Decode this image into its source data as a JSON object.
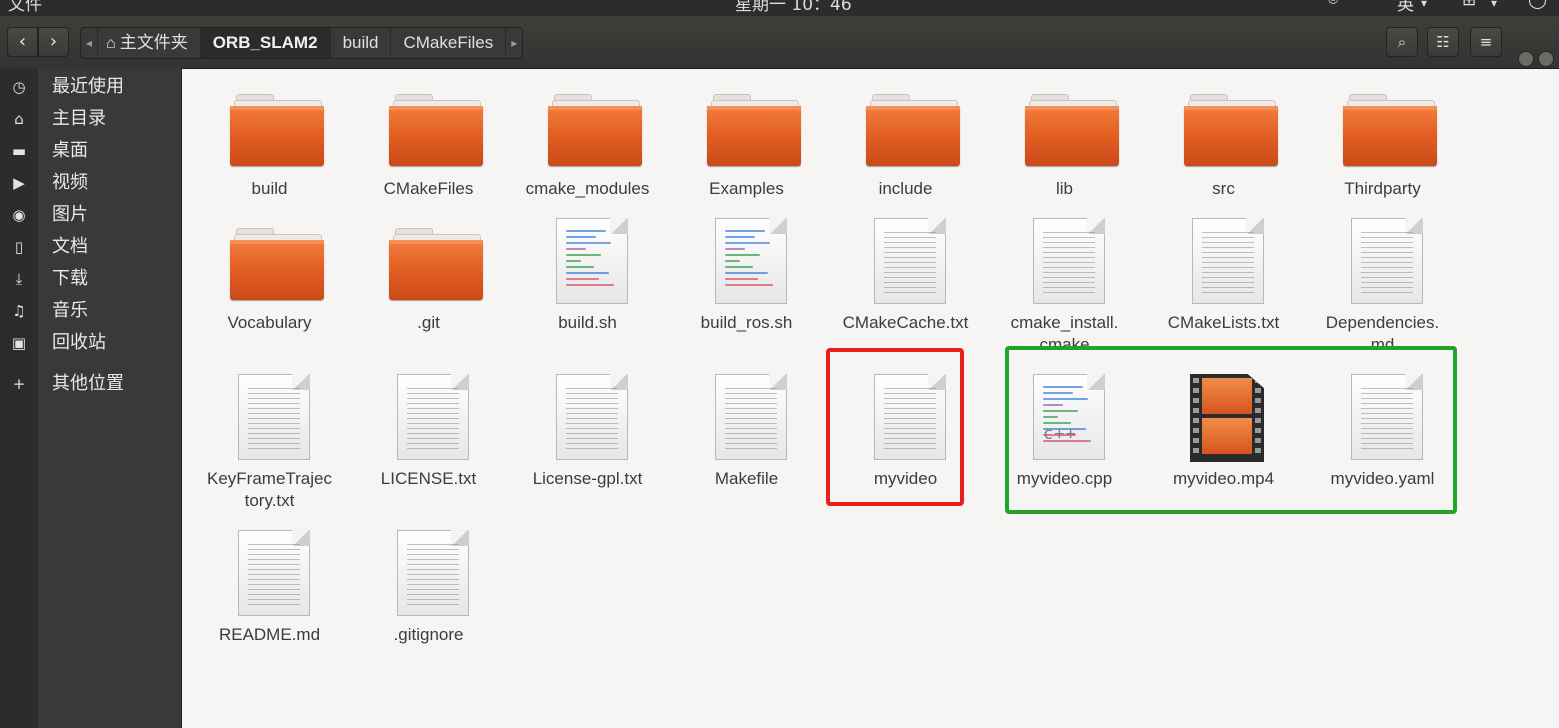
{
  "topbar": {
    "app_menu": "文件",
    "clock": "星期一 10：46",
    "input_method": "英"
  },
  "headerbar": {
    "back": "‹",
    "forward": "›",
    "path": [
      {
        "label": "主文件夹",
        "icon": "home-icon"
      },
      {
        "label": "ORB_SLAM2",
        "current": true
      },
      {
        "label": "build"
      },
      {
        "label": "CMakeFiles"
      }
    ],
    "search_icon": "search-icon",
    "view_icon": "view-options-icon",
    "menu_icon": "hamburger-menu-icon"
  },
  "sidebar": {
    "items": [
      {
        "label": "最近使用",
        "icon": "clock-icon"
      },
      {
        "label": "主目录",
        "icon": "home-icon"
      },
      {
        "label": "桌面",
        "icon": "folder-icon"
      },
      {
        "label": "视频",
        "icon": "video-icon"
      },
      {
        "label": "图片",
        "icon": "camera-icon"
      },
      {
        "label": "文档",
        "icon": "document-icon"
      },
      {
        "label": "下载",
        "icon": "download-icon"
      },
      {
        "label": "音乐",
        "icon": "music-icon"
      },
      {
        "label": "回收站",
        "icon": "trash-icon"
      },
      {
        "label": "其他位置",
        "icon": "plus-icon"
      }
    ]
  },
  "files": [
    {
      "name": "build",
      "type": "folder"
    },
    {
      "name": "CMakeFiles",
      "type": "folder"
    },
    {
      "name": "cmake_modules",
      "type": "folder"
    },
    {
      "name": "Examples",
      "type": "folder"
    },
    {
      "name": "include",
      "type": "folder"
    },
    {
      "name": "lib",
      "type": "folder"
    },
    {
      "name": "src",
      "type": "folder"
    },
    {
      "name": "Thirdparty",
      "type": "folder"
    },
    {
      "name": "Vocabulary",
      "type": "folder"
    },
    {
      "name": ".git",
      "type": "folder"
    },
    {
      "name": "build.sh",
      "type": "script"
    },
    {
      "name": "build_ros.sh",
      "type": "script"
    },
    {
      "name": "CMakeCache.txt",
      "type": "text"
    },
    {
      "name": "cmake_install.\ncmake",
      "type": "text"
    },
    {
      "name": "CMakeLists.txt",
      "type": "text"
    },
    {
      "name": "Dependencies.\nmd",
      "type": "text"
    },
    {
      "name": "KeyFrameTrajec\ntory.txt",
      "type": "text"
    },
    {
      "name": "LICENSE.txt",
      "type": "text"
    },
    {
      "name": "License-gpl.txt",
      "type": "text"
    },
    {
      "name": "Makefile",
      "type": "text"
    },
    {
      "name": "myvideo",
      "type": "text"
    },
    {
      "name": "myvideo.cpp",
      "type": "cpp"
    },
    {
      "name": "myvideo.mp4",
      "type": "video"
    },
    {
      "name": "myvideo.yaml",
      "type": "text"
    },
    {
      "name": "README.md",
      "type": "text"
    },
    {
      "name": ".gitignore",
      "type": "text"
    }
  ],
  "annotations": {
    "red_box_color": "#e8201d",
    "green_box_color": "#21a527"
  },
  "cpp_tag": "c++"
}
